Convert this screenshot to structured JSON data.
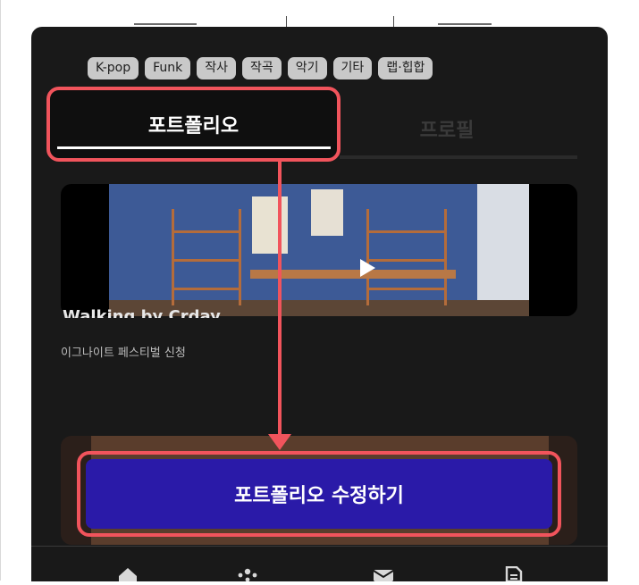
{
  "tags": [
    "K-pop",
    "Funk",
    "작사",
    "작곡",
    "악기",
    "기타",
    "랩·힙합"
  ],
  "tabs": {
    "portfolio": "포트폴리오",
    "profile": "프로필"
  },
  "card1": {
    "title": "Walking by Crday",
    "subtitle": "이그나이트 페스티벌 신청"
  },
  "cta": {
    "label": "포트폴리오 수정하기"
  },
  "colors": {
    "highlight": "#f1545c",
    "cta_bg": "#2a1aa8",
    "panel_bg": "#191919"
  },
  "bottom_nav": [
    "home-icon",
    "community-icon",
    "mail-icon",
    "document-icon"
  ]
}
